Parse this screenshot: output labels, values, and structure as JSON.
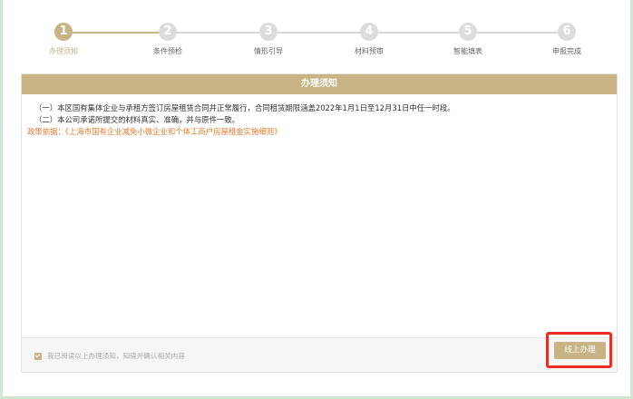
{
  "stepper": {
    "steps": [
      {
        "number": "1",
        "label": "办理须知"
      },
      {
        "number": "2",
        "label": "条件预检"
      },
      {
        "number": "3",
        "label": "情形引导"
      },
      {
        "number": "4",
        "label": "材料预审"
      },
      {
        "number": "5",
        "label": "智能填表"
      },
      {
        "number": "6",
        "label": "申报完成"
      }
    ],
    "active_step": 1,
    "accent_color": "#c7b384"
  },
  "panel": {
    "title": "办理须知",
    "items": [
      "（一）本区国有集体企业与承租方签订房屋租赁合同并正常履行，合同租赁期限涵盖2022年1月1日至12月31日中任一时段。",
      "（二）本公司承诺所提交的材料真实、准确，并与原件一致。"
    ],
    "policy": "政策依据：《上海市国有企业减免小微企业和个体工商户房屋租金实施细则》"
  },
  "footer": {
    "agreement": "我已阅读以上办理须知，知晓并确认相关内容",
    "agreement_checked": true,
    "submit_label": "线上办理"
  }
}
